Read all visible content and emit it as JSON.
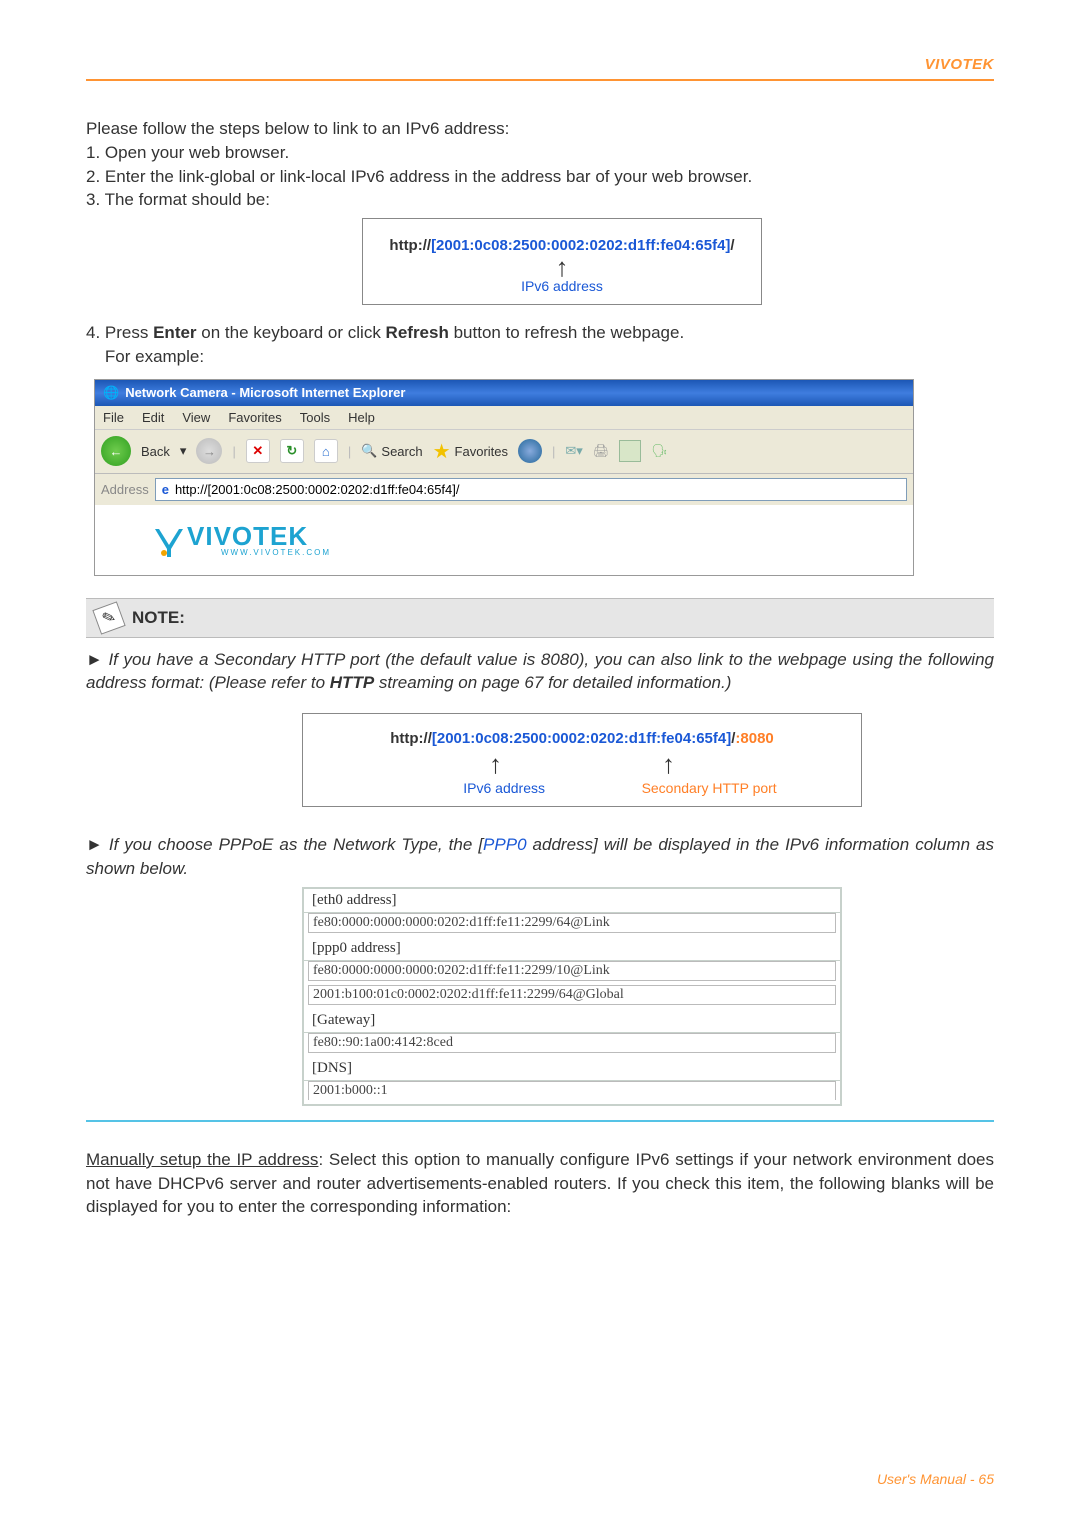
{
  "header": {
    "brand": "VIVOTEK"
  },
  "intro": {
    "line0": "Please follow the steps below to link to an IPv6 address:",
    "line1": "1. Open your web browser.",
    "line2": "2. Enter the link-global or link-local IPv6 address in the address bar of your web browser.",
    "line3": "3. The format should be:"
  },
  "url1": {
    "http": "http://",
    "addr": "[2001:0c08:2500:0002:0202:d1ff:fe04:65f4]",
    "slash": "/",
    "arrow": "↑",
    "label": "IPv6 address"
  },
  "step4": {
    "pre": "4. Press ",
    "enter": "Enter",
    "mid": " on the keyboard or click ",
    "refresh": "Refresh",
    "post": " button to refresh the webpage.",
    "eg": "    For example:"
  },
  "ie": {
    "title": "Network Camera - Microsoft Internet Explorer",
    "menu": [
      "File",
      "Edit",
      "View",
      "Favorites",
      "Tools",
      "Help"
    ],
    "back": "Back",
    "search": "Search",
    "favorites": "Favorites",
    "address_label": "Address",
    "address_value": "http://[2001:0c08:2500:0002:0202:d1ff:fe04:65f4]/",
    "logo_text": "VIVOTEK",
    "logo_sub": "WWW.VIVOTEK.COM"
  },
  "note": {
    "title": "NOTE:",
    "n1_pre": "► If you have a Secondary HTTP port (the default value is 8080), you can also link to the webpage using the following address format: (Please refer to ",
    "n1_http": "HTTP",
    "n1_post": " streaming on page 67 for detailed information.)"
  },
  "url2": {
    "http": "http://",
    "addr": "[2001:0c08:2500:0002:0202:d1ff:fe04:65f4]",
    "slash": "/",
    "port": ":8080",
    "label_addr": "IPv6 address",
    "label_port": "Secondary HTTP port"
  },
  "note2": {
    "pre": "► If you choose PPPoE as the Network Type, the [",
    "ppp": "PPP0",
    "post": " address] will be displayed in the IPv6 information column as shown below."
  },
  "addr_table": {
    "eth0_label": "[eth0 address]",
    "eth0_val": "fe80:0000:0000:0000:0202:d1ff:fe11:2299/64@Link",
    "ppp0_label": "[ppp0 address]",
    "ppp0_val1": "fe80:0000:0000:0000:0202:d1ff:fe11:2299/10@Link",
    "ppp0_val2": "2001:b100:01c0:0002:0202:d1ff:fe11:2299/64@Global",
    "gateway_label": "[Gateway]",
    "gateway_val": "fe80::90:1a00:4142:8ced",
    "dns_label": "[DNS]",
    "dns_val": "2001:b000::1"
  },
  "manual": {
    "u": "Manually setup the IP address",
    "rest": ": Select this option to manually configure IPv6 settings if your network environment does not have DHCPv6 server and router advertisements-enabled routers. If you check this item, the following blanks will be displayed for you to enter the corresponding information:"
  },
  "footer": {
    "text": "User's Manual - 65"
  }
}
